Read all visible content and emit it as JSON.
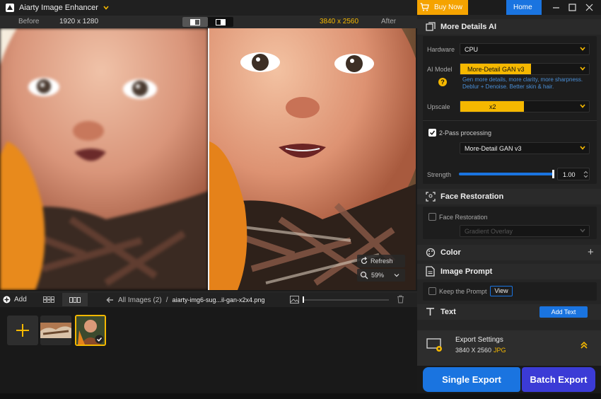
{
  "app": {
    "title": "Aiarty Image Enhancer"
  },
  "compare": {
    "before_label": "Before",
    "before_res": "1920 x 1280",
    "after_res": "3840 x 2560",
    "after_label": "After"
  },
  "viewer": {
    "refresh_label": "Refresh",
    "zoom_label": "59%"
  },
  "toolbar": {
    "add_label": "Add",
    "breadcrumb_all": "All Images (2)",
    "breadcrumb_sep": "/",
    "breadcrumb_file": "aiarty-img6-sug...il-gan-x2x4.png"
  },
  "header": {
    "buy_label": "Buy Now",
    "home_label": "Home"
  },
  "more_details": {
    "title": "More Details AI",
    "hardware_label": "Hardware",
    "hardware_value": "CPU",
    "model_label": "AI Model",
    "model_value": "More-Detail GAN  v3",
    "model_desc_1": "Gen more details, more clarity, more sharpness.",
    "model_desc_2": "Deblur + Denoise. Better skin & hair.",
    "help_icon_text": "?",
    "upscale_label": "Upscale",
    "upscale_value": "x2",
    "two_pass_label": "2-Pass processing",
    "two_pass_checked": true,
    "two_pass_model": "More-Detail GAN  v3",
    "strength_label": "Strength",
    "strength_value": "1.00",
    "strength_level": 1.0
  },
  "face": {
    "title": "Face Restoration",
    "checkbox_label": "Face Restoration",
    "checked": false,
    "mode_value": "Gradient Overlay"
  },
  "color": {
    "title": "Color",
    "plus_icon_text": "+"
  },
  "prompt": {
    "title": "Image Prompt",
    "keep_label": "Keep the Prompt",
    "view_label": "View"
  },
  "text_section": {
    "title": "Text",
    "add_label": "Add Text"
  },
  "export": {
    "title": "Export Settings",
    "resolution": "3840 X 2560",
    "format": "JPG",
    "single_label": "Single Export",
    "batch_label": "Batch Export"
  },
  "colors": {
    "accent": "#f5b800",
    "blue": "#1a74e0",
    "panel": "#252525",
    "purple": "#3b3bd6"
  }
}
